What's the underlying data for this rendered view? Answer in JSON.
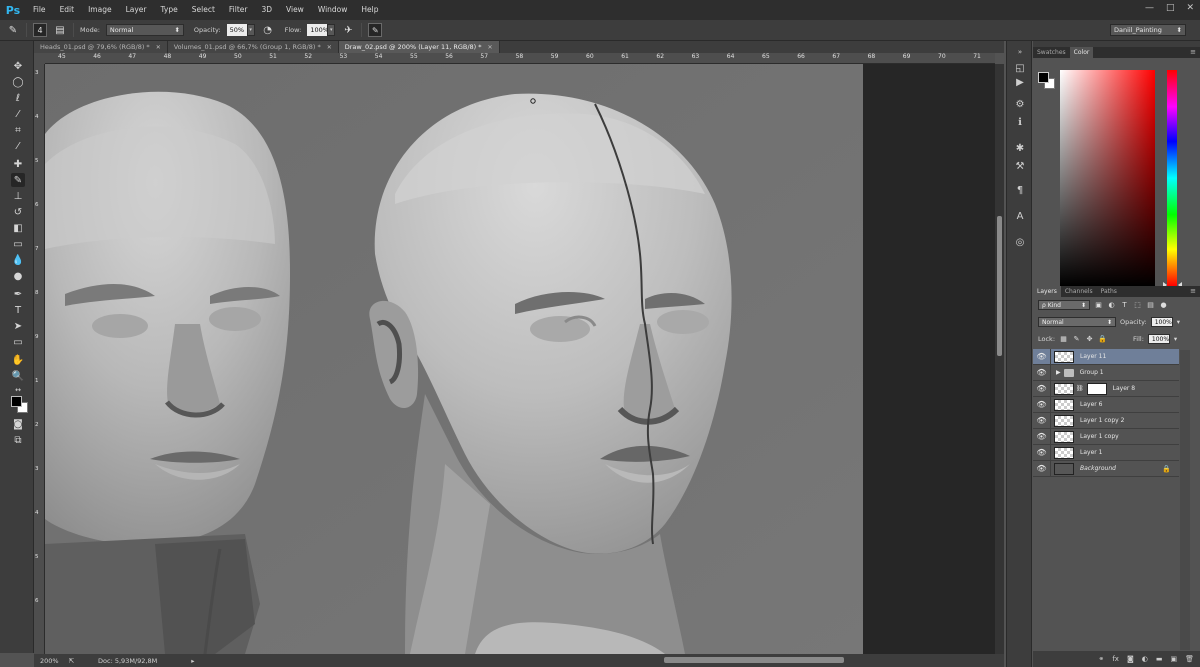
{
  "app": {
    "logo": "Ps"
  },
  "menu": [
    "File",
    "Edit",
    "Image",
    "Layer",
    "Type",
    "Select",
    "Filter",
    "3D",
    "View",
    "Window",
    "Help"
  ],
  "window_controls": {
    "minimize": "—",
    "maximize": "□",
    "close": "✕"
  },
  "options_bar": {
    "mode_label": "Mode:",
    "mode_value": "Normal",
    "opacity_label": "Opacity:",
    "opacity_value": "50%",
    "flow_label": "Flow:",
    "flow_value": "100%",
    "brush_size": "4"
  },
  "workspace": "Daniil_Painting",
  "tabs": [
    {
      "label": "Heads_01.psd @ 79,6% (RGB/8) *",
      "active": false
    },
    {
      "label": "Volumes_01.psd @ 66,7% (Group 1, RGB/8) *",
      "active": false
    },
    {
      "label": "Draw_02.psd @ 200% (Layer 11, RGB/8) *",
      "active": true
    }
  ],
  "ruler_h": [
    "45",
    "46",
    "47",
    "48",
    "49",
    "50",
    "51",
    "52",
    "53",
    "54",
    "55",
    "56",
    "57",
    "58",
    "59",
    "60",
    "61",
    "62",
    "63",
    "64",
    "65",
    "66",
    "67",
    "68",
    "69",
    "70",
    "71"
  ],
  "ruler_v": [
    "3",
    "4",
    "5",
    "6",
    "7",
    "8",
    "9",
    "1",
    "2",
    "3",
    "4",
    "5",
    "6"
  ],
  "status": {
    "zoom": "200%",
    "doc": "Doc: 5,93M/92,8M"
  },
  "colors": {
    "foreground": "#000000",
    "background": "#ffffff",
    "layer_selected": "#6f7f99"
  },
  "color_panel": {
    "tabs": [
      "Swatches",
      "Color"
    ],
    "active_tab": "Color"
  },
  "layers_panel": {
    "tabs": [
      "Layers",
      "Channels",
      "Paths"
    ],
    "active_tab": "Layers",
    "filter": "ρ Kind",
    "blend_mode": "Normal",
    "opacity_label": "Opacity:",
    "opacity_value": "100%",
    "lock_label": "Lock:",
    "fill_label": "Fill:",
    "fill_value": "100%",
    "layers": [
      {
        "name": "Layer 11",
        "type": "layer",
        "selected": true
      },
      {
        "name": "Group 1",
        "type": "group",
        "selected": false
      },
      {
        "name": "Layer 8",
        "type": "masked",
        "selected": false
      },
      {
        "name": "Layer 6",
        "type": "layer",
        "selected": false
      },
      {
        "name": "Layer 1 copy 2",
        "type": "layer",
        "selected": false
      },
      {
        "name": "Layer 1 copy",
        "type": "layer",
        "selected": false
      },
      {
        "name": "Layer 1",
        "type": "layer",
        "selected": false
      },
      {
        "name": "Background",
        "type": "background",
        "selected": false
      }
    ],
    "footer_icons": [
      "link-icon",
      "fx-icon",
      "mask-icon",
      "adjustment-icon",
      "folder-icon",
      "new-layer-icon",
      "trash-icon"
    ]
  }
}
